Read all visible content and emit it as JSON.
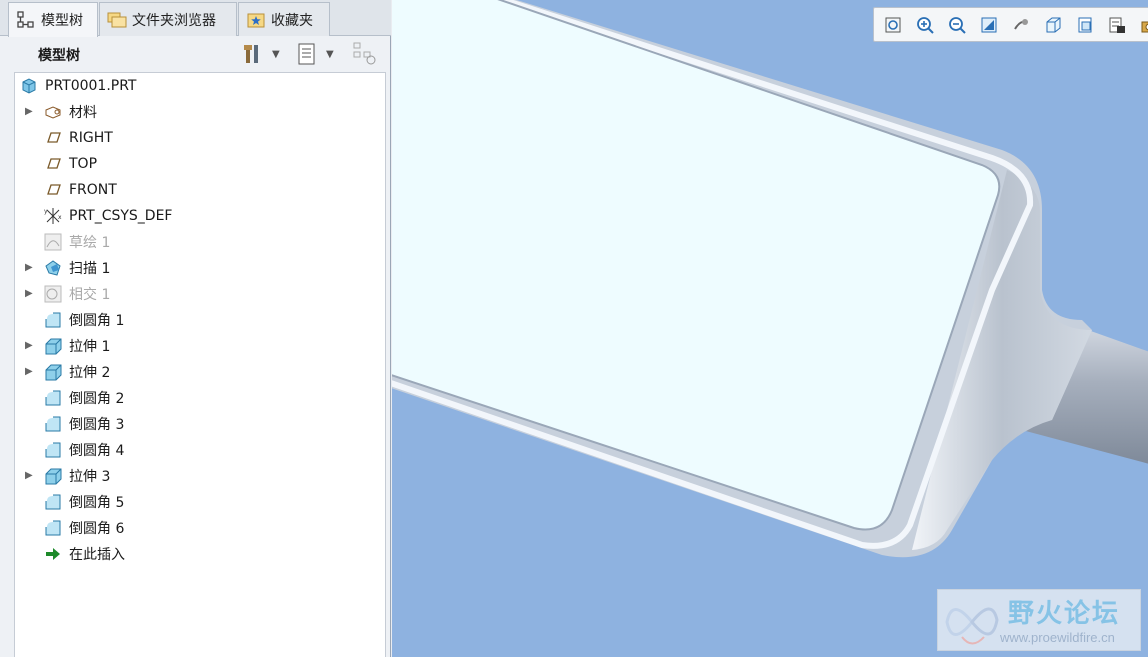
{
  "tabs": [
    {
      "label": "模型树",
      "icon": "model-tree-icon",
      "active": true
    },
    {
      "label": "文件夹浏览器",
      "icon": "folder-browser-icon",
      "active": false
    },
    {
      "label": "收藏夹",
      "icon": "favorites-icon",
      "active": false
    }
  ],
  "tree_header": {
    "title": "模型树",
    "settings_icon": "tools-icon",
    "show_icon": "list-settings-icon",
    "filter_icon": "tree-filter-icon"
  },
  "tree": {
    "root": "PRT0001.PRT",
    "items": [
      {
        "label": "材料",
        "icon": "material-icon",
        "expandable": true,
        "disabled": false
      },
      {
        "label": "RIGHT",
        "icon": "datum-plane-icon",
        "expandable": false,
        "disabled": false
      },
      {
        "label": "TOP",
        "icon": "datum-plane-icon",
        "expandable": false,
        "disabled": false
      },
      {
        "label": "FRONT",
        "icon": "datum-plane-icon",
        "expandable": false,
        "disabled": false
      },
      {
        "label": "PRT_CSYS_DEF",
        "icon": "coordinate-system-icon",
        "expandable": false,
        "disabled": false
      },
      {
        "label": "草绘 1",
        "icon": "sketch-icon",
        "expandable": false,
        "disabled": true
      },
      {
        "label": "扫描 1",
        "icon": "sweep-icon",
        "expandable": true,
        "disabled": false
      },
      {
        "label": "相交 1",
        "icon": "intersect-icon",
        "expandable": true,
        "disabled": true
      },
      {
        "label": "倒圆角 1",
        "icon": "round-icon",
        "expandable": false,
        "disabled": false
      },
      {
        "label": "拉伸 1",
        "icon": "extrude-icon",
        "expandable": true,
        "disabled": false
      },
      {
        "label": "拉伸 2",
        "icon": "extrude-icon",
        "expandable": true,
        "disabled": false
      },
      {
        "label": "倒圆角 2",
        "icon": "round-icon",
        "expandable": false,
        "disabled": false
      },
      {
        "label": "倒圆角 3",
        "icon": "round-icon",
        "expandable": false,
        "disabled": false
      },
      {
        "label": "倒圆角 4",
        "icon": "round-icon",
        "expandable": false,
        "disabled": false
      },
      {
        "label": "拉伸 3",
        "icon": "extrude-icon",
        "expandable": true,
        "disabled": false
      },
      {
        "label": "倒圆角 5",
        "icon": "round-icon",
        "expandable": false,
        "disabled": false
      },
      {
        "label": "倒圆角 6",
        "icon": "round-icon",
        "expandable": false,
        "disabled": false
      },
      {
        "label": "在此插入",
        "icon": "insert-here-arrow-icon",
        "expandable": false,
        "disabled": false
      }
    ]
  },
  "view_toolbar": [
    "refit-icon",
    "zoom-in-icon",
    "zoom-out-icon",
    "repaint-icon",
    "spin-center-icon",
    "display-style-icon",
    "saved-views-icon",
    "view-manager-icon",
    "camera-icon"
  ],
  "watermark": {
    "title": "野火论坛",
    "url": "www.proewildfire.cn"
  },
  "colors": {
    "viewport_bg": "#8eb2e0",
    "model_face": "#eefcff",
    "model_edge": "#a9b6c6"
  }
}
